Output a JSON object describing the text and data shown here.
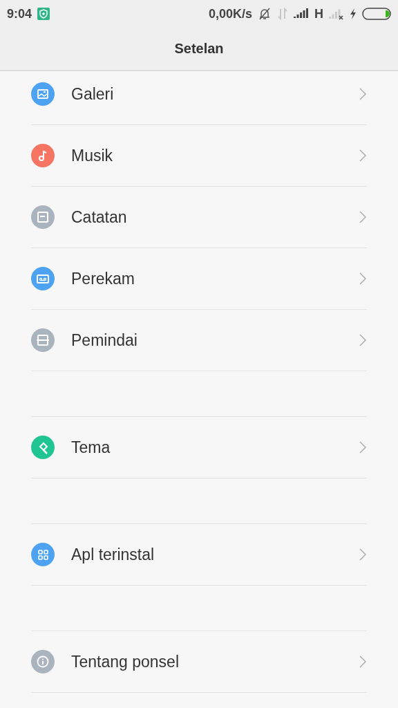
{
  "status_bar": {
    "time": "9:04",
    "speed": "0,00K/s",
    "network": "H"
  },
  "header": {
    "title": "Setelan"
  },
  "groups": [
    {
      "items": [
        {
          "label": "Galeri",
          "kind": "image",
          "color": "#4da3f2"
        },
        {
          "label": "Musik",
          "kind": "music",
          "color": "#f57462"
        },
        {
          "label": "Catatan",
          "kind": "note",
          "color": "#aab4bf"
        },
        {
          "label": "Perekam",
          "kind": "recorder",
          "color": "#4da3f2"
        },
        {
          "label": "Pemindai",
          "kind": "scanner",
          "color": "#aab4bf"
        }
      ]
    },
    {
      "items": [
        {
          "label": "Tema",
          "kind": "theme",
          "color": "#1fc592"
        }
      ]
    },
    {
      "items": [
        {
          "label": "Apl terinstal",
          "kind": "apps",
          "color": "#4da3f2"
        }
      ]
    },
    {
      "items": [
        {
          "label": "Tentang ponsel",
          "kind": "info",
          "color": "#aab4bf"
        }
      ]
    }
  ]
}
